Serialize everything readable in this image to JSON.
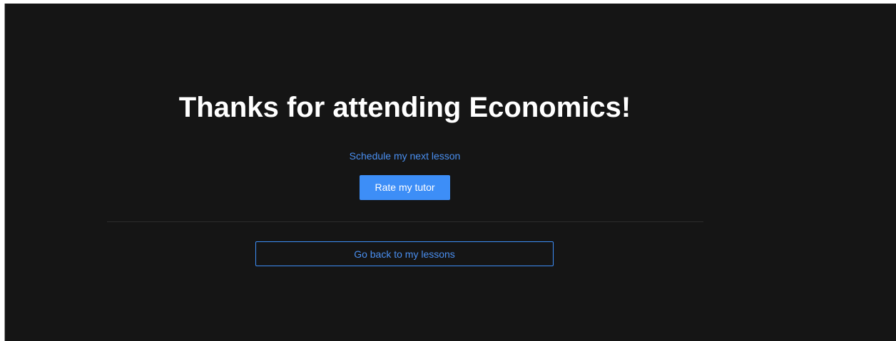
{
  "main": {
    "title": "Thanks for attending Economics!",
    "schedule_link_label": "Schedule my next lesson",
    "rate_button_label": "Rate my tutor",
    "back_button_label": "Go back to my lessons"
  },
  "colors": {
    "background": "#151515",
    "title": "#ffffff",
    "accent": "#3d8ef7",
    "link": "#4a8ff0",
    "divider": "#2c2c2c"
  }
}
